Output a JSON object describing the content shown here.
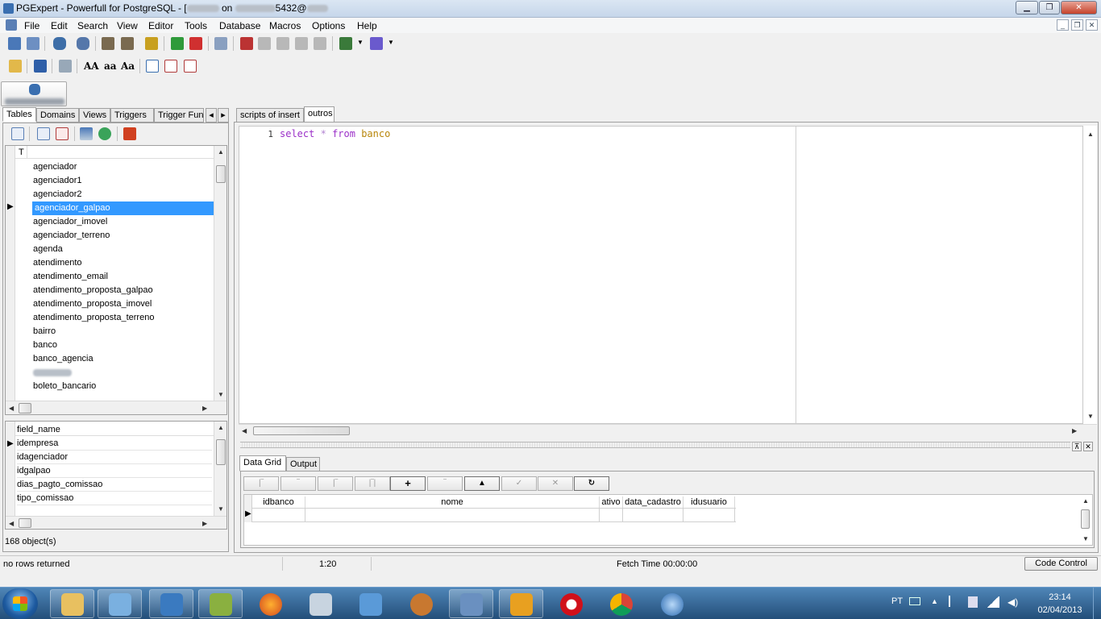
{
  "window": {
    "title_prefix": "PGExpert - Powerfull for PostgreSQL - [",
    "title_mid": " on ",
    "title_port": "5432@"
  },
  "menu": [
    "File",
    "Edit",
    "Search",
    "View",
    "Editor",
    "Tools",
    "Database",
    "Macros",
    "Options",
    "Help"
  ],
  "left_tabs": [
    "Tables",
    "Domains",
    "Views",
    "Triggers",
    "Trigger Func"
  ],
  "table_list": {
    "header": "T",
    "selected_index": 3,
    "items": [
      "agenciador",
      "agenciador1",
      "agenciador2",
      "agenciador_galpao",
      "agenciador_imovel",
      "agenciador_terreno",
      "agenda",
      "atendimento",
      "atendimento_email",
      "atendimento_proposta_galpao",
      "atendimento_proposta_imovel",
      "atendimento_proposta_terreno",
      "bairro",
      "banco",
      "banco_agencia",
      "",
      "boleto_bancario"
    ]
  },
  "field_list": {
    "header": "field_name",
    "items": [
      "idempresa",
      "idagenciador",
      "idgalpao",
      "dias_pagto_comissao",
      "tipo_comissao"
    ]
  },
  "object_count": "168 object(s)",
  "editor_tabs": [
    "scripts of insert",
    "outros"
  ],
  "editor": {
    "line_number": "1",
    "tokens": {
      "kw1": "select",
      "star": "*",
      "kw2": "from",
      "ident": "banco"
    }
  },
  "result_tabs": [
    "Data Grid",
    "Output"
  ],
  "grid_columns": [
    "idbanco",
    "nome",
    "ativo",
    "data_cadastro",
    "idusuario"
  ],
  "status": {
    "message": "no rows returned",
    "position": "1:20",
    "fetch": "Fetch Time 00:00:00",
    "code_control": "Code Control"
  },
  "tray": {
    "lang": "PT",
    "time": "23:14",
    "date": "02/04/2013"
  },
  "colors": {
    "selection": "#3399ff",
    "keyword": "#9b30c8",
    "ident": "#b8860b",
    "taskbar": "#2f5f8f"
  }
}
